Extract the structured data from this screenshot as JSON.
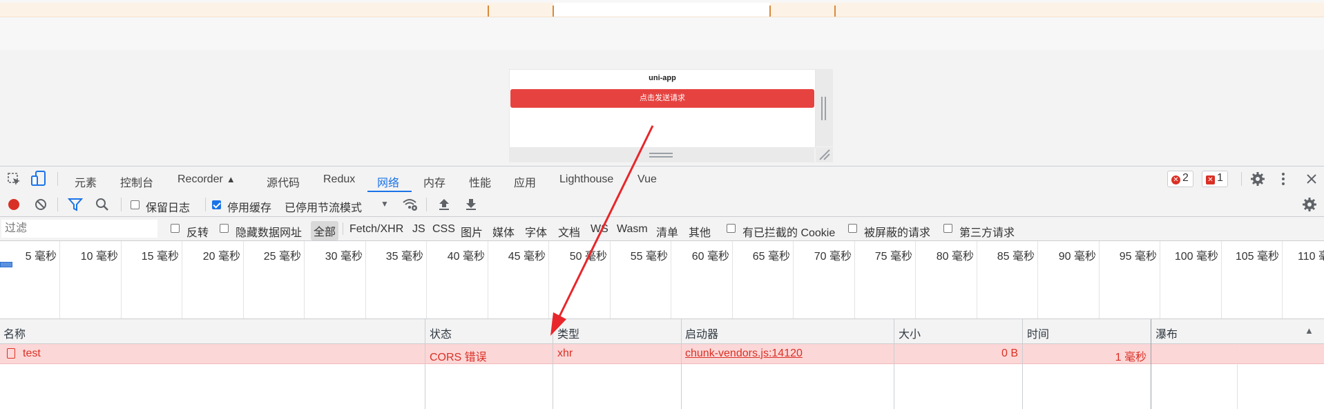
{
  "device": {
    "title": "uni-app",
    "button_label": "点击发送请求"
  },
  "tabs": [
    {
      "label": "元素"
    },
    {
      "label": "控制台"
    },
    {
      "label": "Recorder"
    },
    {
      "label": "源代码"
    },
    {
      "label": "Redux"
    },
    {
      "label": "网络"
    },
    {
      "label": "内存"
    },
    {
      "label": "性能"
    },
    {
      "label": "应用"
    },
    {
      "label": "Lighthouse"
    },
    {
      "label": "Vue"
    }
  ],
  "active_tab": "网络",
  "issues": {
    "errors_count": "2",
    "issues_count": "1"
  },
  "toolbar": {
    "preserve_log": "保留日志",
    "disable_cache": "停用缓存",
    "throttling": "已停用节流模式"
  },
  "filterbar": {
    "filter_placeholder": "过滤",
    "invert": "反转",
    "hide_data_urls": "隐藏数据网址",
    "types": [
      "全部",
      "Fetch/XHR",
      "JS",
      "CSS",
      "图片",
      "媒体",
      "字体",
      "文档",
      "WS",
      "Wasm",
      "清单",
      "其他"
    ],
    "blocked_cookies": "有已拦截的 Cookie",
    "blocked_requests": "被屏蔽的请求",
    "third_party": "第三方请求"
  },
  "ruler_ticks": [
    "5 毫秒",
    "10 毫秒",
    "15 毫秒",
    "20 毫秒",
    "25 毫秒",
    "30 毫秒",
    "35 毫秒",
    "40 毫秒",
    "45 毫秒",
    "50 毫秒",
    "55 毫秒",
    "60 毫秒",
    "65 毫秒",
    "70 毫秒",
    "75 毫秒",
    "80 毫秒",
    "85 毫秒",
    "90 毫秒",
    "95 毫秒",
    "100 毫秒",
    "105 毫秒",
    "110 毫"
  ],
  "table": {
    "headers": [
      "名称",
      "状态",
      "类型",
      "启动器",
      "大小",
      "时间",
      "瀑布"
    ],
    "rows": [
      {
        "name": "test",
        "status": "CORS 错误",
        "type": "xhr",
        "initiator": "chunk-vendors.js:14120",
        "size": "0 B",
        "time": "1 毫秒"
      }
    ]
  },
  "colors": {
    "accent": "#1a73e8",
    "error": "#d93025",
    "error_row_bg": "#fcd7d7",
    "device_button": "#e64340",
    "annotation_arrow": "#e8262b"
  }
}
